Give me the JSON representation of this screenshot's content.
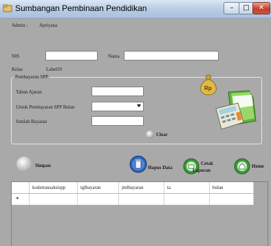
{
  "window": {
    "title": "Sumbangan Pembinaan Pendidikan",
    "minimize_glyph": "–",
    "maximize_glyph": "□",
    "close_glyph": "✕"
  },
  "header": {
    "admin_label": "Admin :",
    "admin_value": "Apriyana"
  },
  "student": {
    "nis_label": "NIS",
    "nis_value": "",
    "nama_label": "Nama",
    "nama_value": "",
    "kelas_label": "Kelas",
    "kelas_value": "Label10"
  },
  "spp_group": {
    "legend": "Pembayaran SPP",
    "tahun_ajaran_label": "Tahun Ajaran",
    "tahun_ajaran_value": "",
    "bulan_label": "Untuk Pembayaran SPP Bulan",
    "bulan_value": "",
    "jumlah_label": "Jumlah Bayaran",
    "jumlah_value": "",
    "clear_label": "Clear",
    "money_bag_text": "Rp"
  },
  "actions": {
    "simpan": "Simpan",
    "hapus": "Hapus Data",
    "cetak_line1": "Cetak",
    "cetak_line2": "Laporan",
    "home": "Home"
  },
  "table": {
    "columns": [
      "kodetransaksispp",
      "tglbayaran",
      "jmlbayaran",
      "ta",
      "bulan"
    ],
    "new_row_marker": "*"
  },
  "colors": {
    "form_background": "#a9a9a9",
    "close_button": "#c2402b",
    "title_bar": "#b9cde4"
  }
}
